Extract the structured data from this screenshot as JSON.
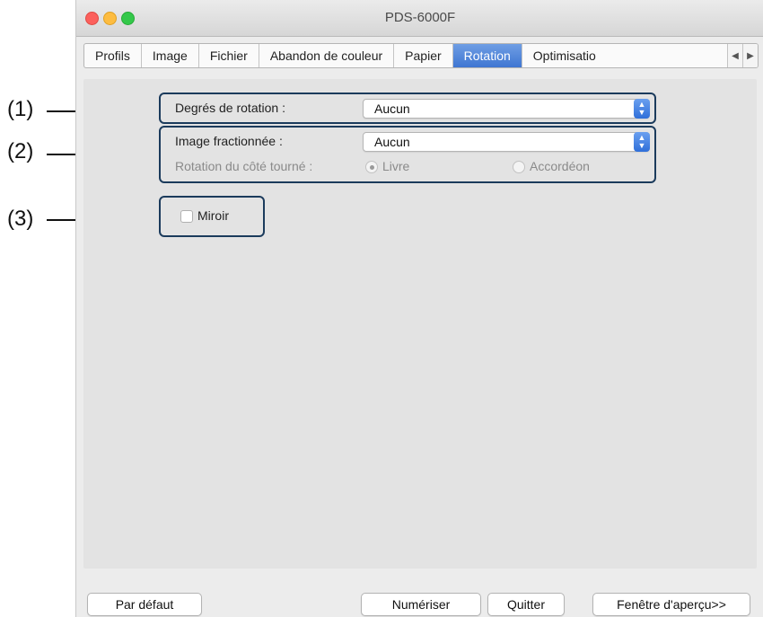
{
  "window": {
    "title": "PDS-6000F"
  },
  "callouts": [
    "(1)",
    "(2)",
    "(3)"
  ],
  "tabs": [
    {
      "label": "Profils",
      "active": false
    },
    {
      "label": "Image",
      "active": false
    },
    {
      "label": "Fichier",
      "active": false
    },
    {
      "label": "Abandon de couleur",
      "active": false
    },
    {
      "label": "Papier",
      "active": false
    },
    {
      "label": "Rotation",
      "active": true
    },
    {
      "label": "Optimisatio",
      "active": false
    }
  ],
  "tab_nav": {
    "prev_icon": "◀",
    "next_icon": "▶"
  },
  "rotation": {
    "degrees_label": "Degrés de rotation :",
    "degrees_value": "Aucun",
    "split_label": "Image fractionnée :",
    "split_value": "Aucun",
    "side_label": "Rotation du côté tourné :",
    "option_book": "Livre",
    "option_accordion": "Accordéon",
    "selected_option": "Livre",
    "mirror_label": "Miroir",
    "mirror_checked": false
  },
  "buttons": {
    "default": "Par défaut",
    "scan": "Numériser",
    "quit": "Quitter",
    "preview": "Fenêtre d'aperçu>>"
  },
  "colors": {
    "accent": "#3f76d2",
    "callout_border": "#1b3b5c"
  }
}
